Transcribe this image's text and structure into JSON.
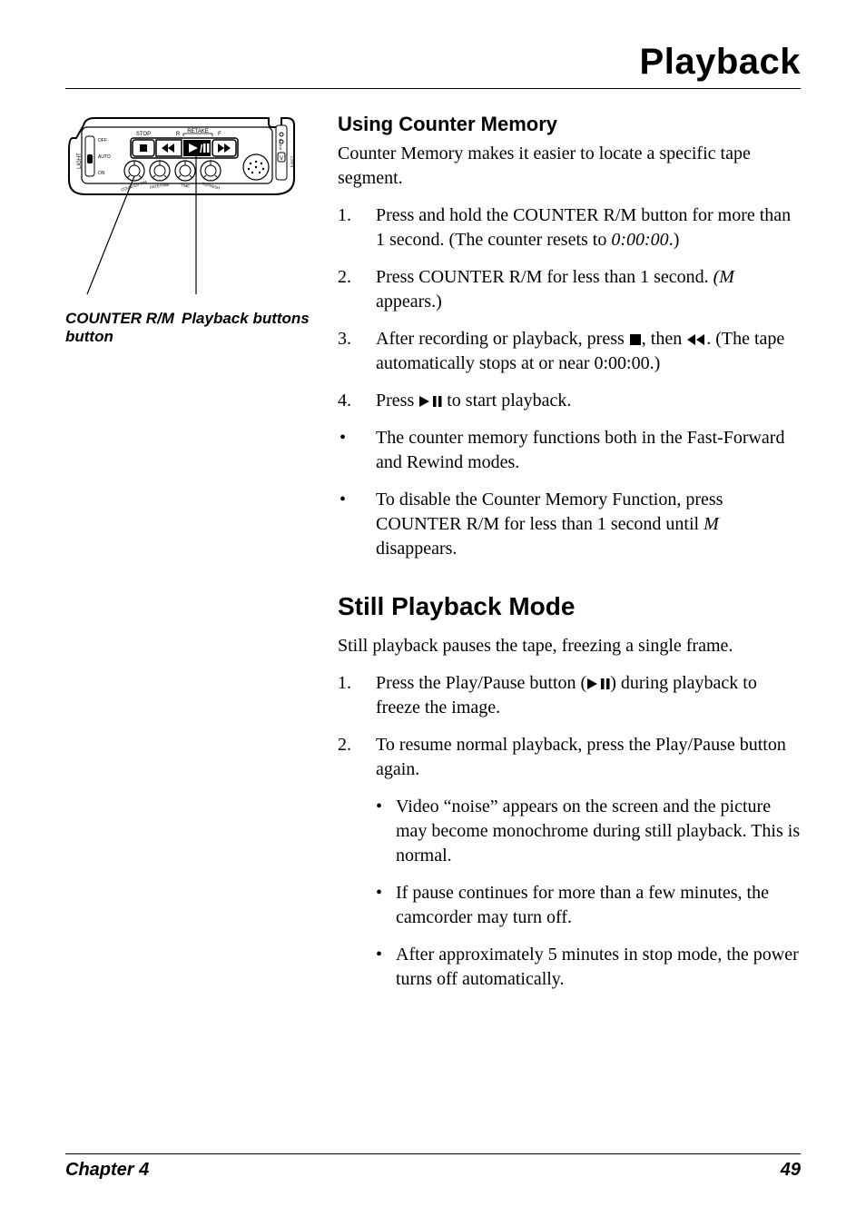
{
  "header_title": "Playback",
  "diagram": {
    "labels": {
      "stop": "STOP",
      "r": "R",
      "retake": "RETAKE",
      "f": "F",
      "light": "LIGHT",
      "off": "OFF",
      "auto": "AUTO",
      "on": "ON",
      "counter_rm": "COUNTER R/M",
      "date_time": "DATE/TIME",
      "time": "TIME",
      "audio_out": "AUDIO",
      "refresh": "REFRESH",
      "eject": "EJECT",
      "v": "V"
    },
    "caption_left_line1": "COUNTER R/M",
    "caption_left_line2": "button",
    "caption_right": "Playback buttons"
  },
  "section_using_counter": {
    "title": "Using Counter Memory",
    "intro": "Counter Memory makes it easier to locate a specific tape segment.",
    "steps": [
      {
        "num": "1.",
        "text_before": "Press and hold the COUNTER R/M button for more than 1 second. (The counter resets to ",
        "italic": "0:00:00",
        "text_after": ".)"
      },
      {
        "num": "2.",
        "text_before": "Press COUNTER R/M for less than 1 second. ",
        "italic": "(M",
        "text_after": " appears.)"
      },
      {
        "num": "3.",
        "text_before": "After recording or playback, press ",
        "text_after": ". (The tape automatically stops at or near 0:00:00.)",
        "icons": [
          "stop",
          "rewind"
        ]
      },
      {
        "num": "4.",
        "text_before": "Press ",
        "text_after": " to start playback.",
        "icons": [
          "playpause"
        ]
      }
    ],
    "bullets": [
      "The counter memory functions both in the Fast-Forward and Rewind modes.",
      {
        "text_before": "To disable the Counter Memory Function, press COUNTER R/M for less than 1 second until ",
        "italic": "M",
        "text_after": " disappears."
      }
    ]
  },
  "section_still": {
    "title": "Still Playback Mode",
    "intro": "Still playback pauses the tape, freezing a single frame.",
    "steps": [
      {
        "num": "1.",
        "text_before": "Press the Play/Pause button (",
        "text_after": ") during playback to freeze the image.",
        "icons": [
          "playpause"
        ]
      },
      {
        "num": "2.",
        "text": "To resume normal playback, press the Play/Pause button again."
      }
    ],
    "sub_bullets": [
      "Video “noise” appears on the screen and the picture may become monochrome during still playback. This is normal.",
      "If pause continues for more than a few minutes, the camcorder may turn off.",
      "After approximately 5 minutes in stop mode, the power turns off automatically."
    ]
  },
  "footer": {
    "left": "Chapter 4",
    "right": "49"
  }
}
